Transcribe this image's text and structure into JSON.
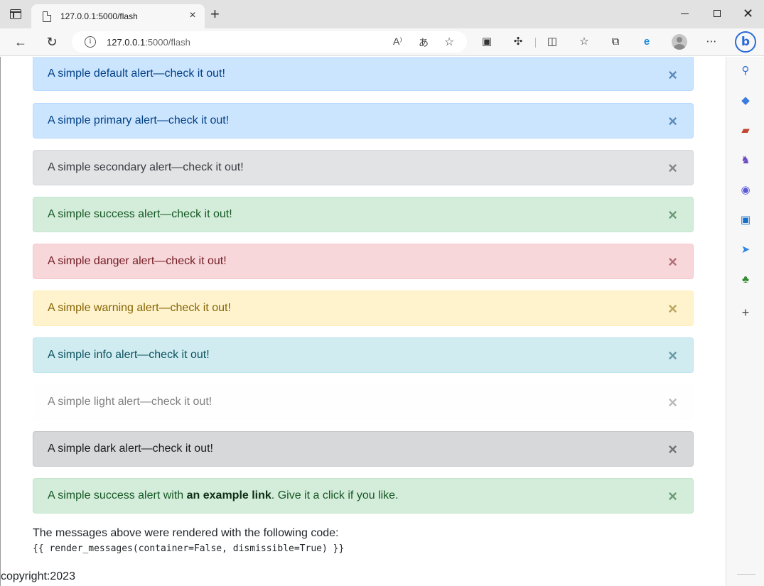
{
  "browser": {
    "tab_title": "127.0.0.1:5000/flash",
    "address_host": "127.0.0.1",
    "address_path": ":5000/flash",
    "icons": {
      "tab_actions": "tab-actions-icon",
      "page": "page-icon",
      "tab_close": "close-icon",
      "new_tab": "plus-icon",
      "back": "back-arrow-icon",
      "refresh": "refresh-icon",
      "info": "info-icon",
      "read_aloud": "read-aloud-icon",
      "translate": "translate-icon",
      "favorite_add": "favorite-add-icon",
      "extensions": "puzzle-icon",
      "split_screen": "split-screen-icon",
      "favorites": "favorites-icon",
      "collections": "collections-icon",
      "ie_mode": "ie-mode-icon",
      "profile": "profile-icon",
      "more": "more-icon",
      "copilot": "bing-icon"
    }
  },
  "alerts": [
    {
      "text": "A simple default alert—check it out!",
      "style": "default"
    },
    {
      "text": "A simple primary alert—check it out!",
      "style": "primary"
    },
    {
      "text": "A simple secondary alert—check it out!",
      "style": "secondary"
    },
    {
      "text": "A simple success alert—check it out!",
      "style": "success"
    },
    {
      "text": "A simple danger alert—check it out!",
      "style": "danger"
    },
    {
      "text": "A simple warning alert—check it out!",
      "style": "warning"
    },
    {
      "text": "A simple info alert—check it out!",
      "style": "info"
    },
    {
      "text": "A simple light alert—check it out!",
      "style": "light"
    },
    {
      "text": "A simple dark alert—check it out!",
      "style": "dark"
    }
  ],
  "link_alert": {
    "before": "A simple success alert with ",
    "link": "an example link",
    "after": ". Give it a click if you like."
  },
  "close_glyph": "×",
  "code_note": "The messages above were rendered with the following code:",
  "code_line": "{{ render_messages(container=False, dismissible=True) }}",
  "footer": "copyright:2023",
  "sidebar": {
    "icons": [
      "search-icon",
      "shopping-tag-icon",
      "toolbox-icon",
      "games-icon",
      "microsoft365-icon",
      "outlook-icon",
      "send-icon",
      "tree-icon",
      "add-icon"
    ]
  }
}
